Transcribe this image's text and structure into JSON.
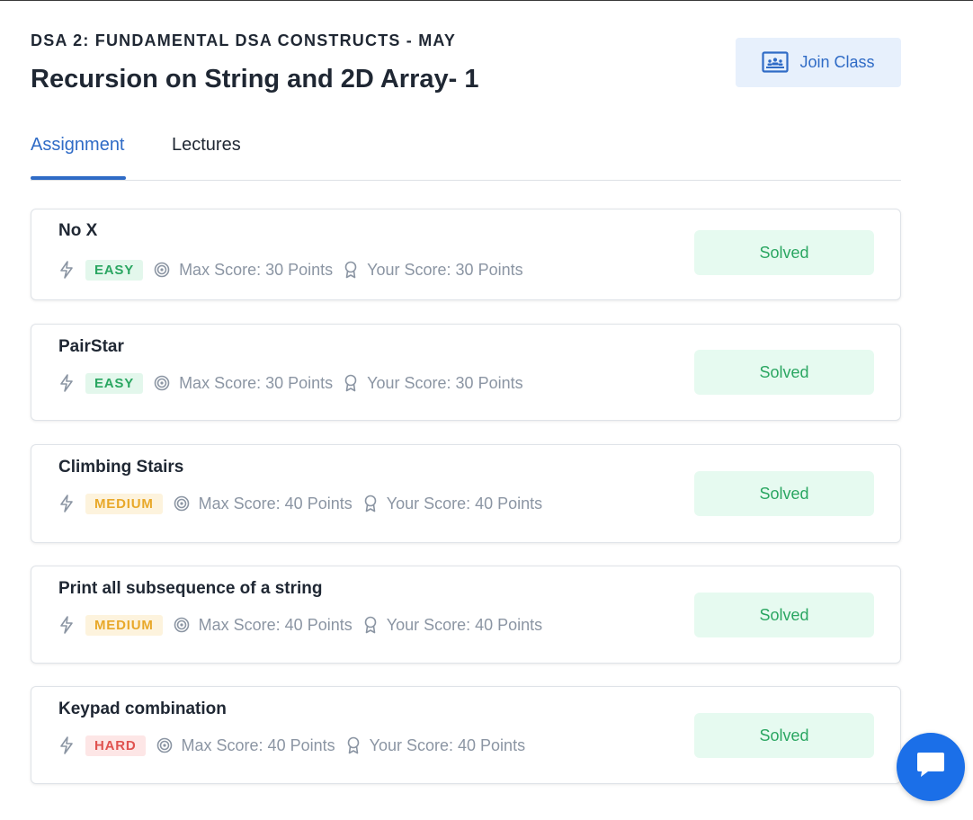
{
  "course": "DSA 2: FUNDAMENTAL DSA CONSTRUCTS - MAY",
  "lesson_title": "Recursion on String and 2D Array- 1",
  "join_label": "Join Class",
  "tabs": [
    {
      "label": "Assignment",
      "active": true
    },
    {
      "label": "Lectures",
      "active": false
    }
  ],
  "problems": [
    {
      "title": "No X",
      "difficulty": "EASY",
      "max_score": "Max Score: 30 Points",
      "your_score": "Your Score: 30 Points",
      "status": "Solved"
    },
    {
      "title": "PairStar",
      "difficulty": "EASY",
      "max_score": "Max Score: 30 Points",
      "your_score": "Your Score: 30 Points",
      "status": "Solved"
    },
    {
      "title": "Climbing Stairs",
      "difficulty": "MEDIUM",
      "max_score": "Max Score: 40 Points",
      "your_score": "Your Score: 40 Points",
      "status": "Solved"
    },
    {
      "title": "Print all subsequence of a string",
      "difficulty": "MEDIUM",
      "max_score": "Max Score: 40 Points",
      "your_score": "Your Score: 40 Points",
      "status": "Solved"
    },
    {
      "title": "Keypad combination",
      "difficulty": "HARD",
      "max_score": "Max Score: 40 Points",
      "your_score": "Your Score: 40 Points",
      "status": "Solved"
    }
  ],
  "colors": {
    "accent": "#2f6bc6",
    "easy": "#2aa661",
    "medium": "#e8a829",
    "hard": "#e0524f",
    "solved_bg": "#e6faf0",
    "chat": "#1b6fe8"
  },
  "icons": {
    "difficulty": "lightning-icon",
    "max_score": "target-icon",
    "your_score": "award-icon",
    "join": "classroom-icon",
    "chat": "chat-bubble-icon"
  }
}
